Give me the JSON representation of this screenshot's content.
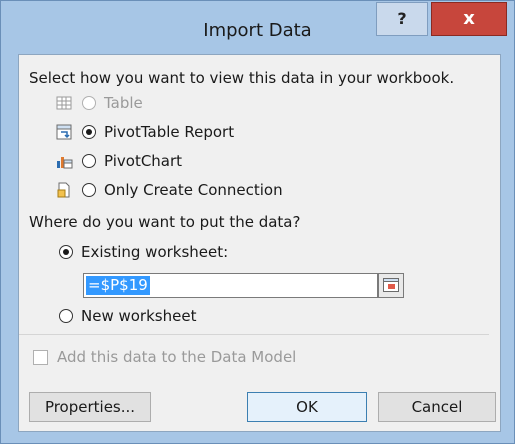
{
  "dialog": {
    "title": "Import Data",
    "help_label": "?",
    "close_label": "x"
  },
  "view_section": {
    "prompt": "Select how you want to view this data in your workbook.",
    "options": [
      {
        "label": "Table",
        "selected": false,
        "enabled": false,
        "icon": "table-icon"
      },
      {
        "label": "PivotTable Report",
        "selected": true,
        "enabled": true,
        "icon": "pivottable-icon"
      },
      {
        "label": "PivotChart",
        "selected": false,
        "enabled": true,
        "icon": "pivotchart-icon"
      },
      {
        "label": "Only Create Connection",
        "selected": false,
        "enabled": true,
        "icon": "connection-icon"
      }
    ]
  },
  "location_section": {
    "prompt": "Where do you want to put the data?",
    "existing_label": "Existing worksheet:",
    "existing_selected": true,
    "cell_reference": "=$P$19",
    "new_label": "New worksheet",
    "new_selected": false
  },
  "data_model": {
    "label": "Add this data to the Data Model",
    "checked": false,
    "enabled": false
  },
  "buttons": {
    "properties": "Properties...",
    "ok": "OK",
    "cancel": "Cancel"
  }
}
